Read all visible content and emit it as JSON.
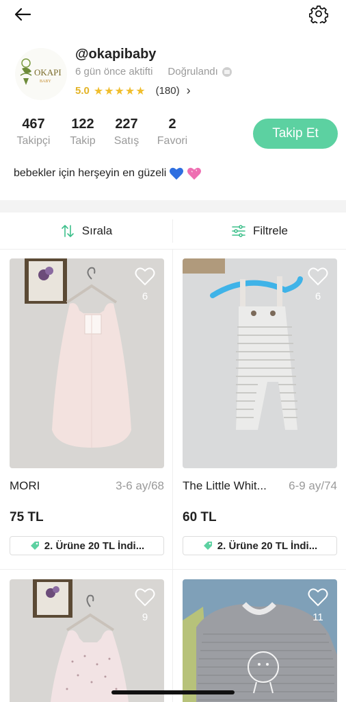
{
  "header": {
    "back_icon": "arrow-left-icon",
    "settings_icon": "gear-icon"
  },
  "profile": {
    "logo_text": "OKAPI",
    "logo_subtext": "BABY",
    "username": "@okapibaby",
    "last_active": "6 gün önce aktifti",
    "verified_label": "Doğrulandı",
    "rating_value": "5.0",
    "stars": "★★★★★",
    "rating_count": "(180)",
    "bio": "bebekler için herşeyin en güzeli"
  },
  "stats": [
    {
      "value": "467",
      "label": "Takipçi"
    },
    {
      "value": "122",
      "label": "Takip"
    },
    {
      "value": "227",
      "label": "Satış"
    },
    {
      "value": "2",
      "label": "Favori"
    }
  ],
  "follow_button": "Takip Et",
  "toolbar": {
    "sort_label": "Sırala",
    "filter_label": "Filtrele"
  },
  "products": [
    {
      "likes": "6",
      "title": "MORI",
      "size": "3-6 ay/68",
      "price": "75 TL",
      "promo": "2. Ürüne 20 TL İndi..."
    },
    {
      "likes": "6",
      "title": "The Little Whit...",
      "size": "6-9 ay/74",
      "price": "60 TL",
      "promo": "2. Ürüne 20 TL İndi..."
    },
    {
      "likes": "9"
    },
    {
      "likes": "11"
    }
  ],
  "colors": {
    "accent": "#5cd1a1",
    "star": "#f0be2d",
    "rating": "#e3b326",
    "muted": "#9a9a9a"
  }
}
